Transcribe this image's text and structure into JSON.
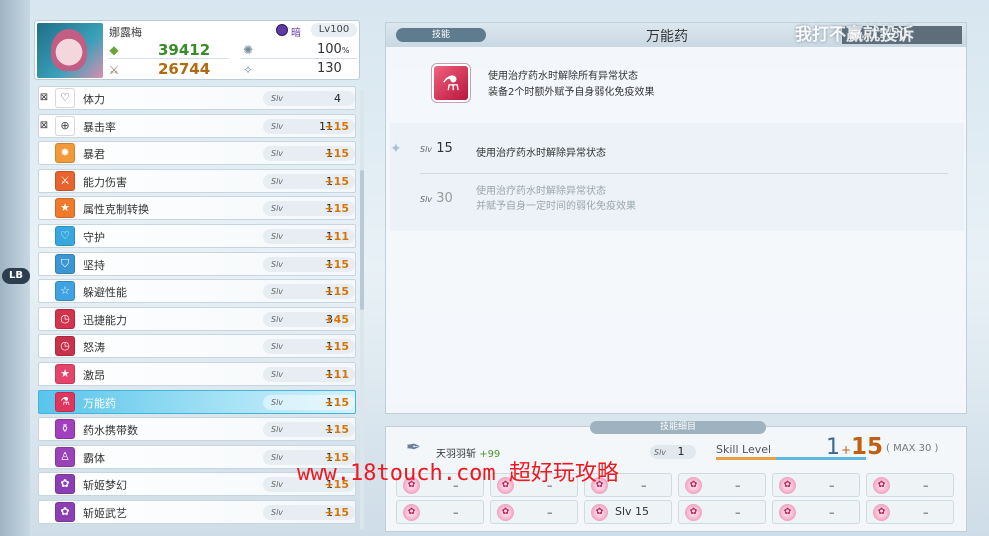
{
  "character": {
    "name": "娜露梅",
    "element": "暗",
    "level": "Lv100",
    "hp": "39412",
    "atk": "26744",
    "percent": "100",
    "percent_unit": "%",
    "number": "130"
  },
  "lb_label": "LB",
  "skills": [
    {
      "name": "体力",
      "locked": true,
      "base": "4",
      "plus": "",
      "color": "#ffffff",
      "icon": "heart-icon"
    },
    {
      "name": "暴击率",
      "locked": true,
      "base": "11",
      "plus": "+15",
      "color": "#ffffff",
      "icon": "crosshair-icon"
    },
    {
      "name": "暴君",
      "locked": false,
      "base": "1",
      "plus": "+15",
      "color": "#f29a3a",
      "icon": "tyrant-icon"
    },
    {
      "name": "能力伤害",
      "locked": false,
      "base": "1",
      "plus": "+15",
      "color": "#e9632f",
      "icon": "sword-icon"
    },
    {
      "name": "属性克制转换",
      "locked": false,
      "base": "1",
      "plus": "+15",
      "color": "#f07a2a",
      "icon": "star-icon"
    },
    {
      "name": "守护",
      "locked": false,
      "base": "1",
      "plus": "+11",
      "color": "#37a7e0",
      "icon": "heart-shield-icon"
    },
    {
      "name": "坚持",
      "locked": false,
      "base": "1",
      "plus": "+15",
      "color": "#3a96d4",
      "icon": "shield-icon"
    },
    {
      "name": "躲避性能",
      "locked": false,
      "base": "1",
      "plus": "+15",
      "color": "#3fa2e2",
      "icon": "star-outline-icon"
    },
    {
      "name": "迅捷能力",
      "locked": false,
      "base": "3",
      "plus": "+45",
      "color": "#d4334e",
      "icon": "clock-icon"
    },
    {
      "name": "怒涛",
      "locked": false,
      "base": "1",
      "plus": "+15",
      "color": "#c9304a",
      "icon": "clock-icon"
    },
    {
      "name": "激昂",
      "locked": false,
      "base": "1",
      "plus": "+11",
      "color": "#e5456a",
      "icon": "star-icon"
    },
    {
      "name": "万能药",
      "locked": false,
      "base": "1",
      "plus": "+15",
      "color": "#e0365e",
      "icon": "potion-icon",
      "selected": true
    },
    {
      "name": "药水携带数",
      "locked": false,
      "base": "1",
      "plus": "+15",
      "color": "#a13fbe",
      "icon": "flask-icon"
    },
    {
      "name": "霸体",
      "locked": false,
      "base": "1",
      "plus": "+15",
      "color": "#9a42b8",
      "icon": "body-icon"
    },
    {
      "name": "斩姬梦幻",
      "locked": false,
      "base": "1",
      "plus": "+15",
      "color": "#8c3fb5",
      "icon": "flower-icon"
    },
    {
      "name": "斩姬武艺",
      "locked": false,
      "base": "1",
      "plus": "+15",
      "color": "#8c3fb5",
      "icon": "flower-icon"
    }
  ],
  "slv_label": "Slv",
  "detail": {
    "tag": "技能",
    "title": "万能药",
    "slv_label": "Slv",
    "slv_value": "15/30",
    "desc_line1": "使用治疗药水时解除所有异常状态",
    "desc_line2": "装备2个时额外赋予自身弱化免疫效果",
    "levels": [
      {
        "label": "Slv",
        "value": "15",
        "line1": "使用治疗药水时解除异常状态",
        "line2": ""
      },
      {
        "label": "Slv",
        "value": "30",
        "line1": "使用治疗药水时解除异常状态",
        "line2": "并赋予自身一定时间的弱化免疫效果"
      }
    ]
  },
  "materials": {
    "tag": "技能细目",
    "item_name": "天羽羽斩",
    "item_bonus": "+99",
    "item_slv_label": "Slv",
    "item_slv": "1",
    "skill_level_label": "Skill Level",
    "base": "1",
    "plus": "+",
    "bonus": "15",
    "max": "( MAX 30 )",
    "slots_row1": [
      "–",
      "–",
      "–",
      "–",
      "–",
      "–"
    ],
    "slots_row2": [
      "–",
      "–",
      "Slv 15",
      "–",
      "–",
      "–"
    ]
  },
  "watermarks": {
    "top": "我打不赢就投诉",
    "mid": "www.18touch.com 超好玩攻略"
  }
}
